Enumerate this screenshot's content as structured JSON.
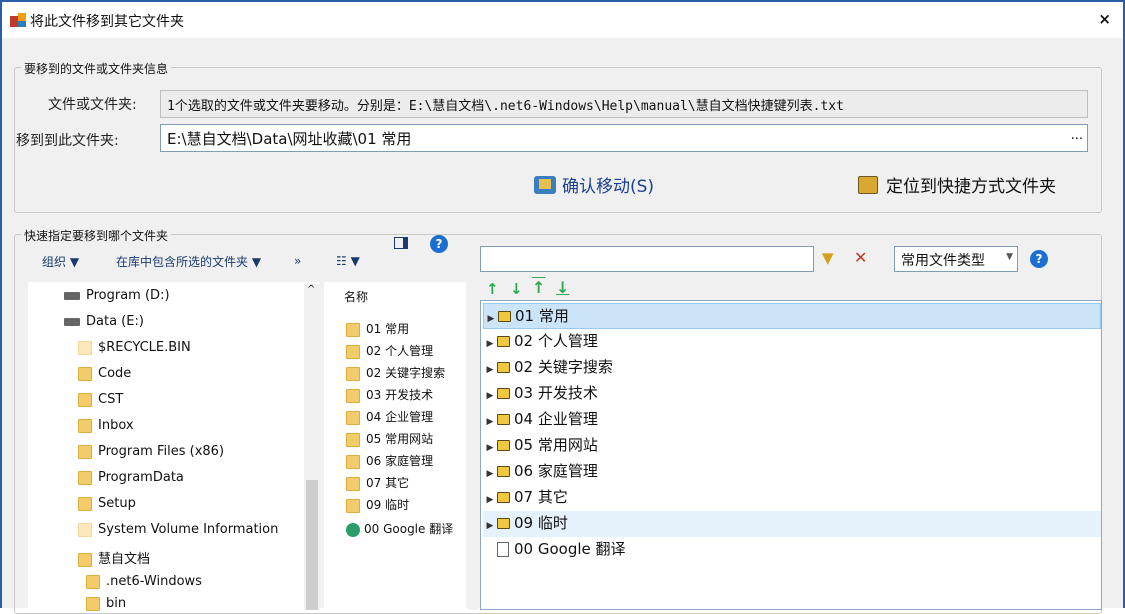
{
  "window": {
    "title": "将此文件移到其它文件夹",
    "close": "×"
  },
  "info": {
    "legend": "要移到的文件或文件夹信息",
    "source_label": "文件或文件夹:",
    "source_value": "1个选取的文件或文件夹要移动。分别是：E:\\慧自文档\\.net6-Windows\\Help\\manual\\慧自文档快捷键列表.txt",
    "target_label": "移到到此文件夹:",
    "target_value": "E:\\慧自文档\\Data\\网址收藏\\01 常用",
    "browse": "...",
    "confirm_button": "确认移动(S)",
    "locate_button": "定位到快捷方式文件夹"
  },
  "quick": {
    "legend": "快速指定要移到哪个文件夹"
  },
  "explorer": {
    "organize": "组织 ▼",
    "include": "在库中包含所选的文件夹 ▼",
    "more": "»",
    "view": "☷ ▼",
    "help": "?",
    "nav_items": [
      {
        "label": "Program (D:)",
        "icon": "drive"
      },
      {
        "label": "Data (E:)",
        "icon": "drive"
      },
      {
        "label": "$RECYCLE.BIN",
        "icon": "folder"
      },
      {
        "label": "Code",
        "icon": "folder"
      },
      {
        "label": "CST",
        "icon": "folder"
      },
      {
        "label": "Inbox",
        "icon": "folder"
      },
      {
        "label": "Program Files (x86)",
        "icon": "folder"
      },
      {
        "label": "ProgramData",
        "icon": "folder"
      },
      {
        "label": "Setup",
        "icon": "folder"
      },
      {
        "label": "System Volume Information",
        "icon": "folder"
      },
      {
        "label": "慧自文档",
        "icon": "folder"
      },
      {
        "label": ".net6-Windows",
        "icon": "folder"
      },
      {
        "label": "bin",
        "icon": "folder"
      }
    ],
    "column_header": "名称",
    "files": [
      "01 常用",
      "02 个人管理",
      "02 关键字搜索",
      "03 开发技术",
      "04 企业管理",
      "05 常用网站",
      "06 家庭管理",
      "07 其它",
      "09 临时",
      "00 Google 翻译"
    ]
  },
  "filter": {
    "search_value": "",
    "filter_icon": "▼",
    "clear_icon": "✕",
    "type_select": "常用文件类型",
    "help": "?"
  },
  "tree": {
    "items": [
      "01 常用",
      "02 个人管理",
      "02 关键字搜索",
      "03 开发技术",
      "04 企业管理",
      "05 常用网站",
      "06 家庭管理",
      "07 其它",
      "09 临时",
      "00 Google 翻译"
    ],
    "selected_index": 0
  }
}
